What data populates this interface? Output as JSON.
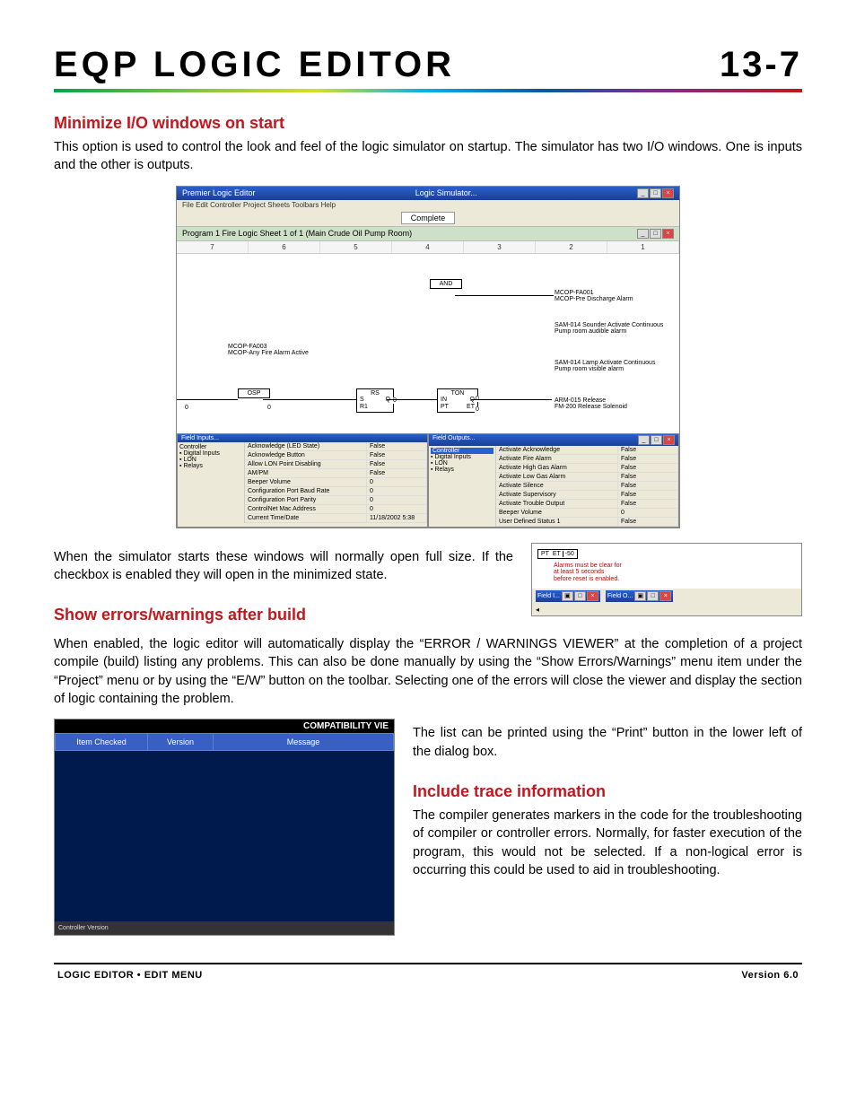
{
  "header": {
    "title": "EQP LOGIC EDITOR",
    "page_number": "13-7"
  },
  "section1": {
    "heading": "Minimize I/O windows on start",
    "para": "This option is used to control the look and feel of the logic simulator on startup.  The simulator has two I/O windows.  One is inputs and the other is outputs."
  },
  "figure1": {
    "app_title": "Premier Logic Editor",
    "sim_title": "Logic Simulator...",
    "complete_label": "Complete",
    "menus": "File  Edit  Controller  Project  Sheets  Toolbars  Help",
    "program_tab": "Program 1 Fire Logic Sheet 1 of 1 (Main Crude Oil Pump Room)",
    "ruler": [
      "7",
      "6",
      "5",
      "4",
      "3",
      "2",
      "1"
    ],
    "blocks": {
      "and": "AND",
      "osp": "OSP",
      "rs": "RS",
      "rs_pins": [
        "S",
        "R1",
        "Q"
      ],
      "ton": "TON",
      "ton_pins": [
        "IN",
        "PT",
        "Q",
        "ET"
      ]
    },
    "labels": {
      "mcopfa003_id": "MCOP-FA003",
      "mcopfa003_desc": "MCOP-Any Fire Alarm Active",
      "mcopfa001_id": "MCOP-FA001",
      "mcopfa001_desc": "MCOP-Pre Discharge Alarm",
      "sam014s_id": "SAM-014 Sounder Activate Continuous",
      "sam014s_desc": "Pump room audible alarm",
      "sam014l_id": "SAM-014 Lamp Activate Continuous",
      "sam014l_desc": "Pump room visible alarm",
      "arm015_id": "ARM-015 Release",
      "arm015_desc": "FM-200 Release Solenoid",
      "zero": "0"
    },
    "inputs_panel": {
      "title": "Field Inputs...",
      "tree": [
        "Controller",
        "Digital Inputs",
        "LON",
        "Relays"
      ],
      "rows": [
        {
          "name": "Acknowledge (LED State)",
          "val": "False"
        },
        {
          "name": "Acknowledge Button",
          "val": "False"
        },
        {
          "name": "Allow LON Point Disabling",
          "val": "False"
        },
        {
          "name": "AM/PM",
          "val": "False"
        },
        {
          "name": "Beeper Volume",
          "val": "0"
        },
        {
          "name": "Configuration Port Baud Rate",
          "val": "0"
        },
        {
          "name": "Configuration Port Parity",
          "val": "0"
        },
        {
          "name": "ControlNet Mac Address",
          "val": "0"
        },
        {
          "name": "Current Time/Date",
          "val": "11/18/2002 5:38"
        }
      ]
    },
    "outputs_panel": {
      "title": "Field Outputs...",
      "tree": [
        "Controller",
        "Digital Inputs",
        "LON",
        "Relays"
      ],
      "rows": [
        {
          "name": "Activate Acknowledge",
          "val": "False"
        },
        {
          "name": "Activate Fire Alarm",
          "val": "False"
        },
        {
          "name": "Activate High Gas Alarm",
          "val": "False"
        },
        {
          "name": "Activate Low Gas Alarm",
          "val": "False"
        },
        {
          "name": "Activate Silence",
          "val": "False"
        },
        {
          "name": "Activate Supervisory",
          "val": "False"
        },
        {
          "name": "Activate Trouble Output",
          "val": "False"
        },
        {
          "name": "Beeper Volume",
          "val": "0"
        },
        {
          "name": "User Defined Status 1",
          "val": "False"
        }
      ]
    }
  },
  "after_fig1_para": "When the simulator starts these windows will normally open full size.  If the checkbox is enabled they will open in the minimized state.",
  "figure2": {
    "pt": "PT",
    "et": "ET",
    "val": "-50",
    "note_l1": "Alarms must be clear for",
    "note_l2": "at least 5 seconds",
    "note_l3": "before reset is enabled.",
    "min1": "Field I...",
    "min2": "Field O..."
  },
  "section2": {
    "heading": "Show errors/warnings after build",
    "para": "When enabled, the logic editor will automatically display the “ERROR / WARNINGS VIEWER” at the completion of a project compile (build) listing any problems.  This can also be done manually by using the “Show Errors/Warnings” menu item under the “Project” menu or by using the “E/W” button on the toolbar.  Selecting one of the errors will close the viewer and display the section of logic containing the problem."
  },
  "figure3": {
    "title": "COMPATIBILITY VIE",
    "cols": [
      "Item Checked",
      "Version",
      "Message"
    ],
    "footer": "Controller Version"
  },
  "right_of_fig3_para": "The list can be printed using the “Print” button in the lower left of the dialog box.",
  "section3": {
    "heading": "Include trace information",
    "para": "The compiler generates markers in the code for the troubleshooting of compiler or controller errors.  Normally, for faster execution of the program, this would not be selected.  If a non-logical error is occurring this could be used to aid in troubleshooting."
  },
  "footer": {
    "left": "LOGIC EDITOR • EDIT MENU",
    "right": "Version 6.0"
  }
}
